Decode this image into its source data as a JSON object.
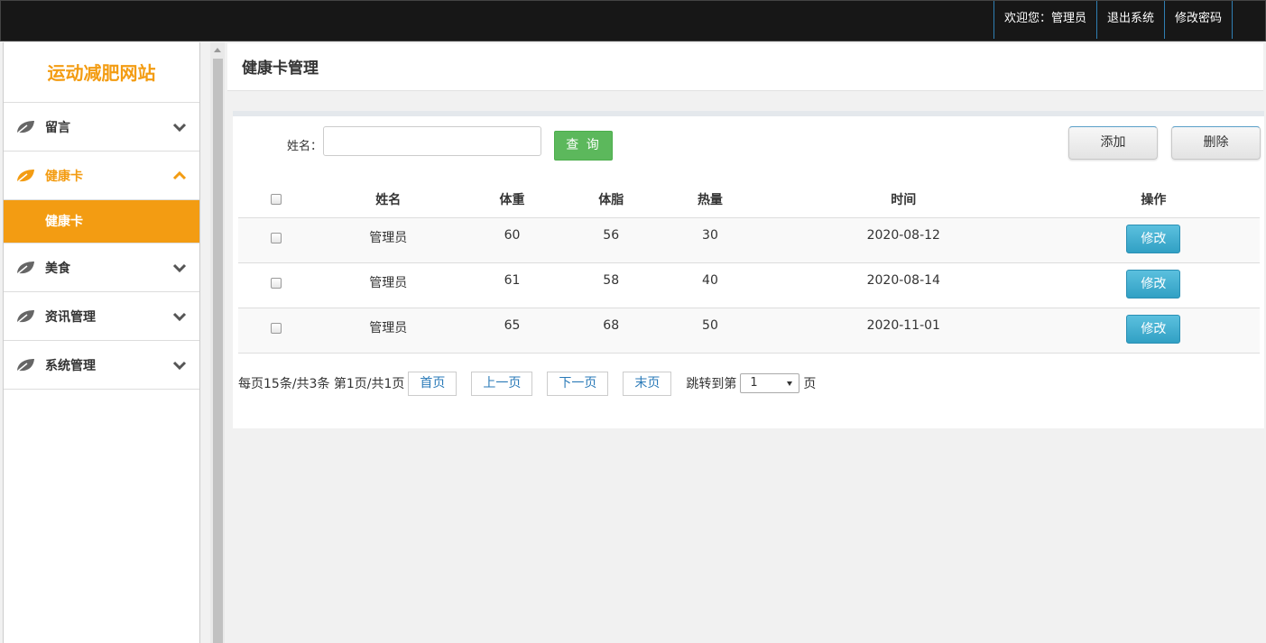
{
  "topbar": {
    "welcome": "欢迎您：管理员",
    "logout": "退出系统",
    "change_password": "修改密码"
  },
  "sidebar": {
    "brand": "运动减肥网站",
    "items": [
      {
        "label": "留言",
        "icon": "leaf-icon",
        "expanded": false
      },
      {
        "label": "健康卡",
        "icon": "leaf-icon",
        "expanded": true
      },
      {
        "label": "美食",
        "icon": "leaf-icon",
        "expanded": false
      },
      {
        "label": "资讯管理",
        "icon": "leaf-icon",
        "expanded": false
      },
      {
        "label": "系统管理",
        "icon": "leaf-icon",
        "expanded": false
      }
    ],
    "sub_item": "健康卡",
    "accent": "#f39c12"
  },
  "page": {
    "title": "健康卡管理"
  },
  "search": {
    "label": "姓名：",
    "value": "",
    "query_button": "查 询"
  },
  "actions": {
    "add": "添加",
    "delete": "删除"
  },
  "table": {
    "columns": [
      "姓名",
      "体重",
      "体脂",
      "热量",
      "时间",
      "操作"
    ],
    "rows": [
      {
        "name": "管理员",
        "weight": "60",
        "fat": "56",
        "calories": "30",
        "date": "2020-08-12",
        "action": "修改"
      },
      {
        "name": "管理员",
        "weight": "61",
        "fat": "58",
        "calories": "40",
        "date": "2020-08-14",
        "action": "修改"
      },
      {
        "name": "管理员",
        "weight": "65",
        "fat": "68",
        "calories": "50",
        "date": "2020-11-01",
        "action": "修改"
      }
    ]
  },
  "pager": {
    "info": "每页15条/共3条 第1页/共1页",
    "first": "首页",
    "prev": "上一页",
    "next": "下一页",
    "last": "末页",
    "jump_label": "跳转到第",
    "page_value": "1",
    "page_suffix": "页"
  }
}
